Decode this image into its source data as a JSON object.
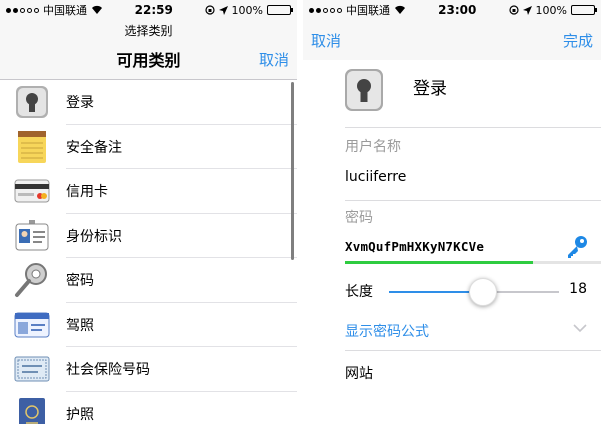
{
  "left": {
    "status": {
      "carrier": "中国联通",
      "time": "22:59",
      "battery": "100%"
    },
    "prompt": "选择类别",
    "title": "可用类别",
    "cancel": "取消",
    "categories": [
      {
        "label": "登录",
        "icon": "safe-lock-icon"
      },
      {
        "label": "安全备注",
        "icon": "notepad-icon"
      },
      {
        "label": "信用卡",
        "icon": "credit-card-icon"
      },
      {
        "label": "身份标识",
        "icon": "id-badge-icon"
      },
      {
        "label": "密码",
        "icon": "key-icon"
      },
      {
        "label": "驾照",
        "icon": "driver-license-icon"
      },
      {
        "label": "社会保险号码",
        "icon": "social-security-card-icon"
      },
      {
        "label": "护照",
        "icon": "passport-icon"
      }
    ]
  },
  "right": {
    "status": {
      "carrier": "中国联通",
      "time": "23:00",
      "battery": "100%"
    },
    "cancel": "取消",
    "done": "完成",
    "item_title": "登录",
    "username_label": "用户名称",
    "username_value": "luciiferre",
    "password_label": "密码",
    "password_value": "XvmQufPmHXKyN7KCVe",
    "length_label": "长度",
    "length_value": "18",
    "length_fraction": 0.55,
    "show_formula": "显示密码公式",
    "website_label": "网站"
  },
  "colors": {
    "accent": "#2e8ee8",
    "strength": "#2ecc40"
  }
}
